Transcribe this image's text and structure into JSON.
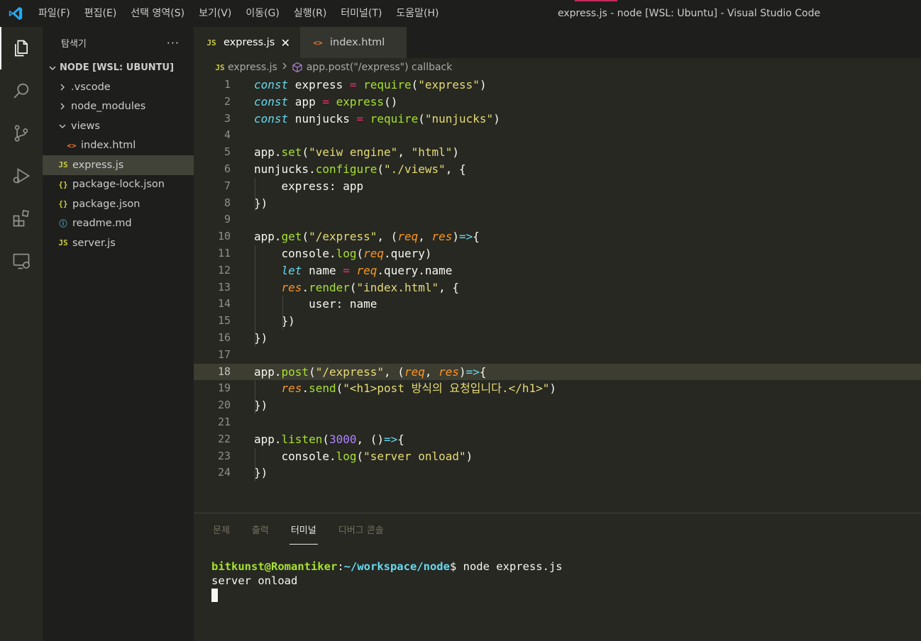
{
  "window_title": "express.js - node [WSL: Ubuntu] - Visual Studio Code",
  "menu": [
    "파일(F)",
    "편집(E)",
    "선택 영역(S)",
    "보기(V)",
    "이동(G)",
    "실행(R)",
    "터미널(T)",
    "도움말(H)"
  ],
  "activity": [
    "explorer-icon",
    "search-icon",
    "source-control-icon",
    "run-debug-icon",
    "extensions-icon",
    "remote-explorer-icon"
  ],
  "sidebar": {
    "title": "탐색기",
    "more": "···",
    "section": "NODE [WSL: UBUNTU]",
    "items": [
      {
        "label": ".vscode",
        "type": "folder",
        "expanded": false
      },
      {
        "label": "node_modules",
        "type": "folder",
        "expanded": false
      },
      {
        "label": "views",
        "type": "folder",
        "expanded": true
      },
      {
        "label": "index.html",
        "type": "html"
      },
      {
        "label": "express.js",
        "type": "js",
        "selected": true
      },
      {
        "label": "package-lock.json",
        "type": "json"
      },
      {
        "label": "package.json",
        "type": "json"
      },
      {
        "label": "readme.md",
        "type": "info"
      },
      {
        "label": "server.js",
        "type": "js"
      }
    ]
  },
  "icons": {
    "js": "JS",
    "json": "{}",
    "html": "<>",
    "info": "ⓘ"
  },
  "tabs": [
    {
      "label": "express.js",
      "icon": "JS",
      "active": true,
      "close": "✕"
    },
    {
      "label": "index.html",
      "icon": "<>",
      "active": false
    }
  ],
  "breadcrumb": {
    "file": "express.js",
    "symbol": "app.post(\"/express\") callback"
  },
  "editor": {
    "current_line": 18,
    "lines": [
      [
        [
          "kw",
          "const"
        ],
        [
          "pl",
          " express "
        ],
        [
          "op",
          "="
        ],
        [
          "pl",
          " "
        ],
        [
          "fn",
          "require"
        ],
        [
          "pl",
          "("
        ],
        [
          "str",
          "\"express\""
        ],
        [
          "pl",
          ")"
        ]
      ],
      [
        [
          "kw",
          "const"
        ],
        [
          "pl",
          " app "
        ],
        [
          "op",
          "="
        ],
        [
          "pl",
          " "
        ],
        [
          "fn",
          "express"
        ],
        [
          "pl",
          "()"
        ]
      ],
      [
        [
          "kw",
          "const"
        ],
        [
          "pl",
          " nunjucks "
        ],
        [
          "op",
          "="
        ],
        [
          "pl",
          " "
        ],
        [
          "fn",
          "require"
        ],
        [
          "pl",
          "("
        ],
        [
          "str",
          "\"nunjucks\""
        ],
        [
          "pl",
          ")"
        ]
      ],
      [],
      [
        [
          "pl",
          "app."
        ],
        [
          "fn",
          "set"
        ],
        [
          "pl",
          "("
        ],
        [
          "str",
          "\"veiw engine\""
        ],
        [
          "pl",
          ", "
        ],
        [
          "str",
          "\"html\""
        ],
        [
          "pl",
          ")"
        ]
      ],
      [
        [
          "pl",
          "nunjucks."
        ],
        [
          "fn",
          "configure"
        ],
        [
          "pl",
          "("
        ],
        [
          "str",
          "\"./views\""
        ],
        [
          "pl",
          ", {"
        ]
      ],
      [
        [
          "pl",
          "    express: app"
        ]
      ],
      [
        [
          "pl",
          "})"
        ]
      ],
      [],
      [
        [
          "pl",
          "app."
        ],
        [
          "fn",
          "get"
        ],
        [
          "pl",
          "("
        ],
        [
          "str",
          "\"/express\""
        ],
        [
          "pl",
          ", ("
        ],
        [
          "param",
          "req"
        ],
        [
          "pl",
          ", "
        ],
        [
          "param",
          "res"
        ],
        [
          "pl",
          ")"
        ],
        [
          "arrow",
          "=>"
        ],
        [
          "pl",
          "{"
        ]
      ],
      [
        [
          "pl",
          "    console."
        ],
        [
          "fn",
          "log"
        ],
        [
          "pl",
          "("
        ],
        [
          "param",
          "req"
        ],
        [
          "pl",
          ".query)"
        ]
      ],
      [
        [
          "pl",
          "    "
        ],
        [
          "kw",
          "let"
        ],
        [
          "pl",
          " name "
        ],
        [
          "op",
          "="
        ],
        [
          "pl",
          " "
        ],
        [
          "param",
          "req"
        ],
        [
          "pl",
          ".query.name"
        ]
      ],
      [
        [
          "pl",
          "    "
        ],
        [
          "param",
          "res"
        ],
        [
          "pl",
          "."
        ],
        [
          "fn",
          "render"
        ],
        [
          "pl",
          "("
        ],
        [
          "str",
          "\"index.html\""
        ],
        [
          "pl",
          ", {"
        ]
      ],
      [
        [
          "pl",
          "        user: name"
        ]
      ],
      [
        [
          "pl",
          "    })"
        ]
      ],
      [
        [
          "pl",
          "})"
        ]
      ],
      [],
      [
        [
          "pl",
          "app."
        ],
        [
          "fn",
          "post"
        ],
        [
          "pl",
          "("
        ],
        [
          "str",
          "\"/express\""
        ],
        [
          "pl",
          ", ("
        ],
        [
          "param",
          "req"
        ],
        [
          "pl",
          ", "
        ],
        [
          "param",
          "res"
        ],
        [
          "pl",
          ")"
        ],
        [
          "arrow",
          "=>"
        ],
        [
          "pl",
          "{"
        ]
      ],
      [
        [
          "pl",
          "    "
        ],
        [
          "param",
          "res"
        ],
        [
          "pl",
          "."
        ],
        [
          "fn",
          "send"
        ],
        [
          "pl",
          "("
        ],
        [
          "str",
          "\"<h1>post 방식의 요청입니다.</h1>\""
        ],
        [
          "pl",
          ")"
        ]
      ],
      [
        [
          "pl",
          "})"
        ]
      ],
      [],
      [
        [
          "pl",
          "app."
        ],
        [
          "fn",
          "listen"
        ],
        [
          "pl",
          "("
        ],
        [
          "num",
          "3000"
        ],
        [
          "pl",
          ", ()"
        ],
        [
          "arrow",
          "=>"
        ],
        [
          "pl",
          "{"
        ]
      ],
      [
        [
          "pl",
          "    console."
        ],
        [
          "fn",
          "log"
        ],
        [
          "pl",
          "("
        ],
        [
          "str",
          "\"server onload\""
        ],
        [
          "pl",
          ")"
        ]
      ],
      [
        [
          "pl",
          "})"
        ]
      ]
    ]
  },
  "panel": {
    "tabs": [
      {
        "label": "문제",
        "active": false
      },
      {
        "label": "출력",
        "active": false
      },
      {
        "label": "터미널",
        "active": true
      },
      {
        "label": "디버그 콘솔",
        "active": false
      }
    ],
    "terminal": {
      "user": "bitkunst@Romantiker",
      "colon": ":",
      "path": "~/workspace/node",
      "prompt": "$ ",
      "command": "node express.js",
      "output": "server onload"
    }
  }
}
